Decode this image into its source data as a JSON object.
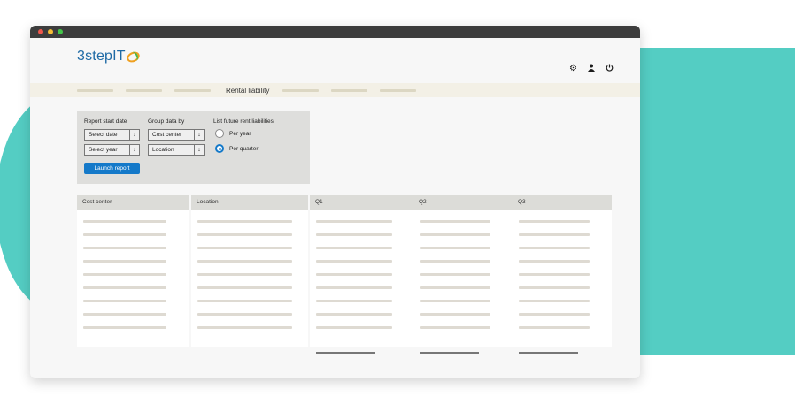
{
  "header": {
    "logo_text": "3stepIT",
    "icons": [
      "gear-icon",
      "user-icon",
      "power-icon"
    ]
  },
  "nav": {
    "active_label": "Rental liability"
  },
  "form": {
    "report_start_label": "Report start date",
    "select_date": "Select date",
    "select_year": "Select year",
    "group_by_label": "Group data by",
    "cost_center": "Cost center",
    "location": "Location",
    "list_label": "List future rent liabilities",
    "per_year": "Per year",
    "per_quarter": "Per quarter",
    "selected_option": "Per quarter",
    "launch_button": "Launch report"
  },
  "table": {
    "columns": [
      "Cost center",
      "Location",
      "Q1",
      "Q2",
      "Q3"
    ]
  },
  "colors": {
    "accent": "#1479c9",
    "teal_background": "#54cdc3",
    "nav_band": "#f3f0e6"
  }
}
